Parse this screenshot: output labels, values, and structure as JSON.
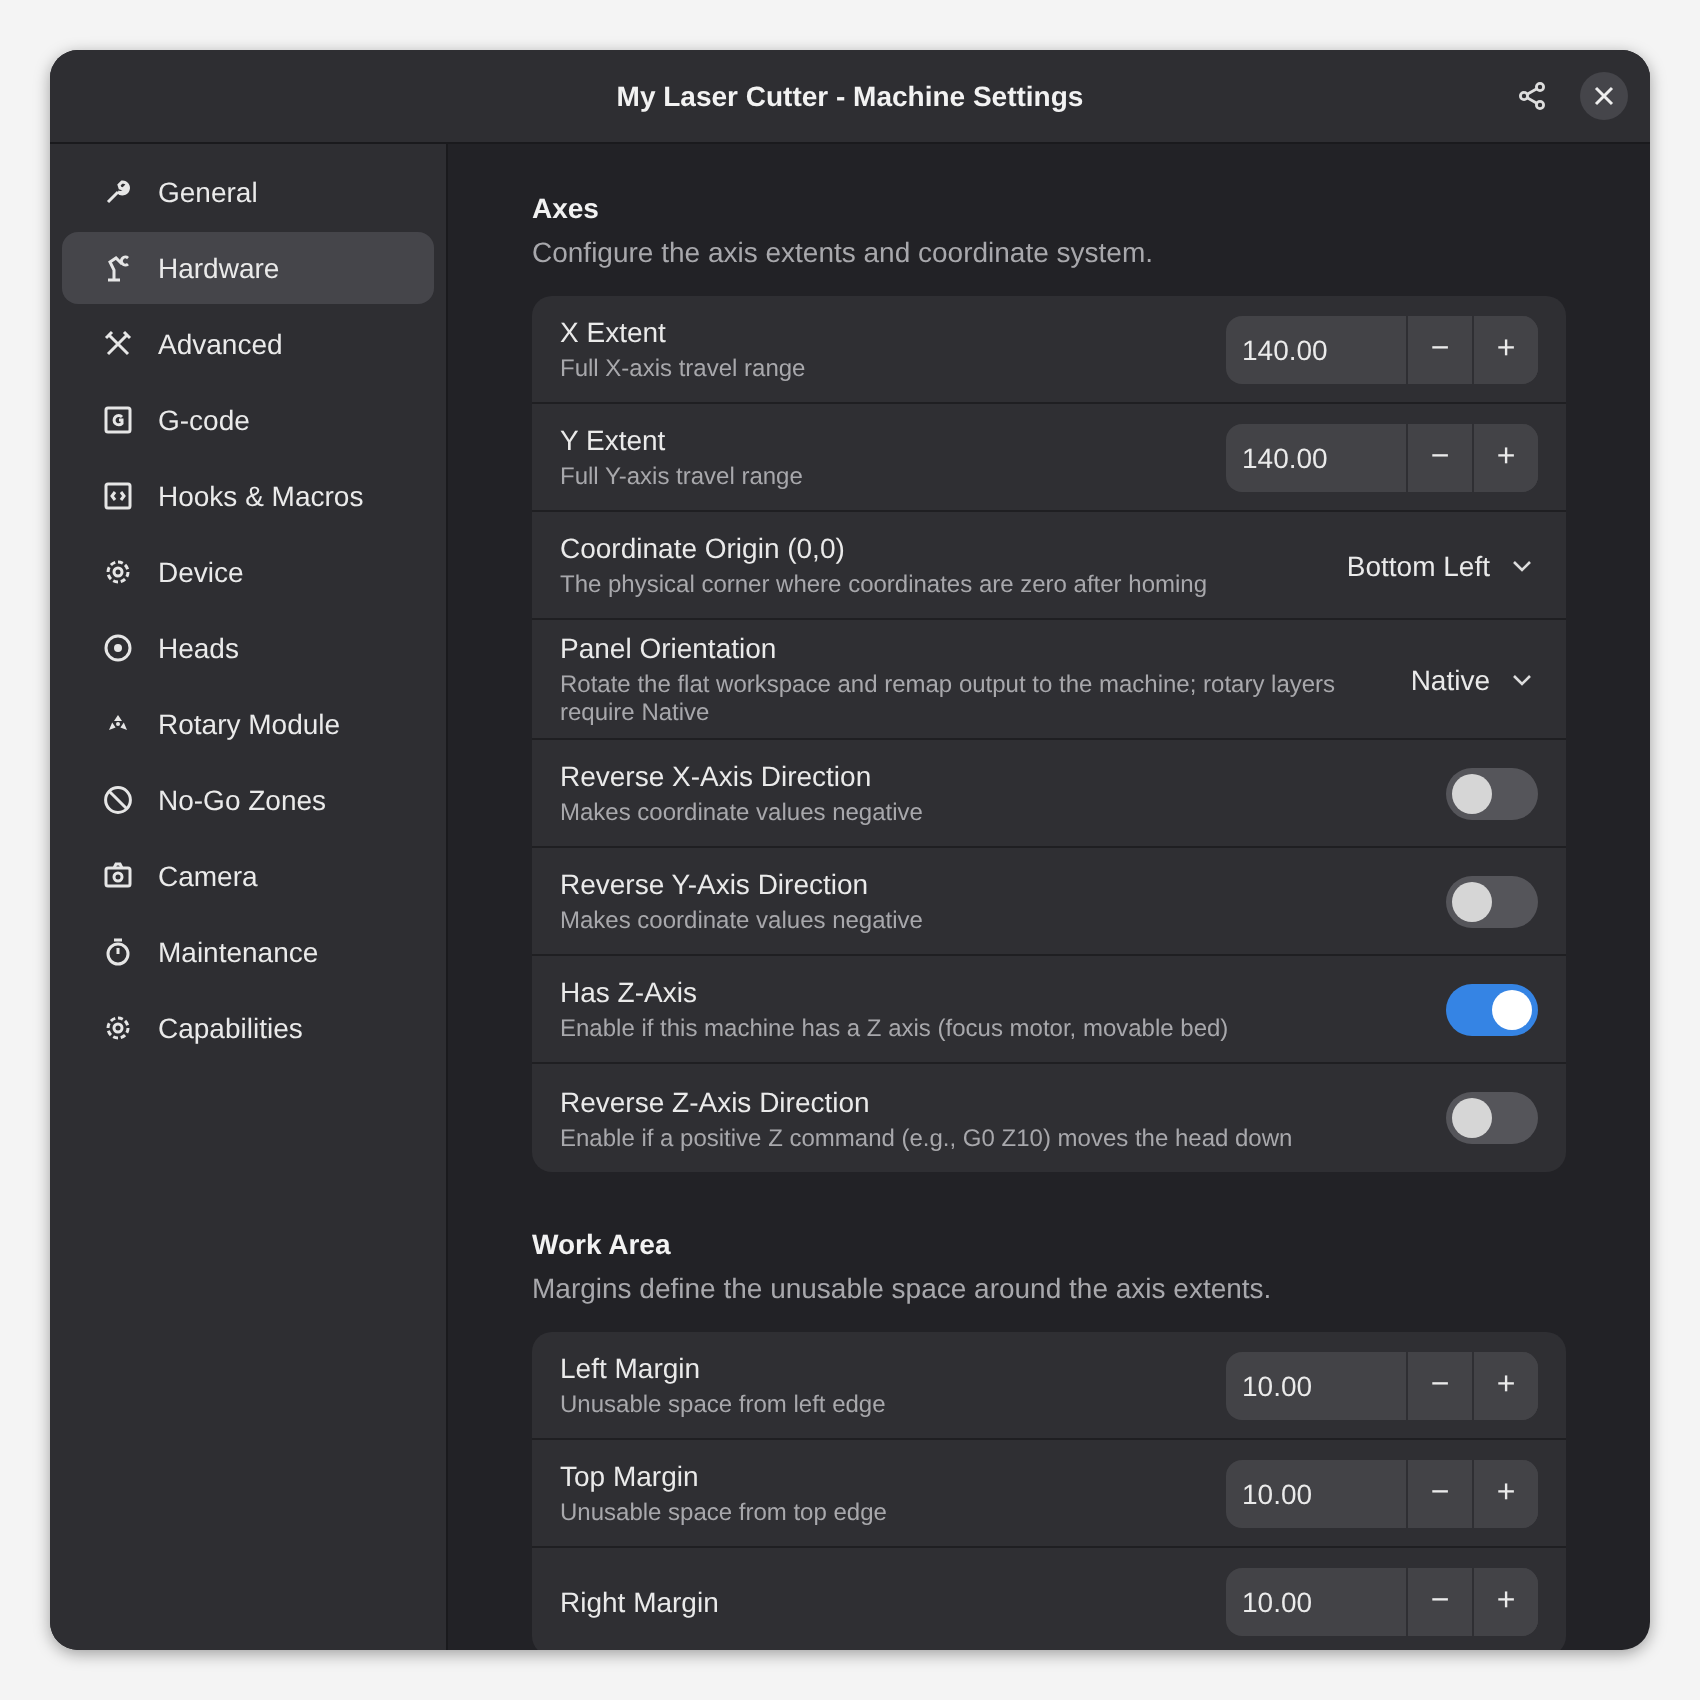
{
  "window": {
    "title": "My Laser Cutter - Machine Settings"
  },
  "sidebar": {
    "items": [
      {
        "label": "General",
        "selected": false
      },
      {
        "label": "Hardware",
        "selected": true
      },
      {
        "label": "Advanced",
        "selected": false
      },
      {
        "label": "G-code",
        "selected": false
      },
      {
        "label": "Hooks & Macros",
        "selected": false
      },
      {
        "label": "Device",
        "selected": false
      },
      {
        "label": "Heads",
        "selected": false
      },
      {
        "label": "Rotary Module",
        "selected": false
      },
      {
        "label": "No-Go Zones",
        "selected": false
      },
      {
        "label": "Camera",
        "selected": false
      },
      {
        "label": "Maintenance",
        "selected": false
      },
      {
        "label": "Capabilities",
        "selected": false
      }
    ]
  },
  "sections": [
    {
      "title": "Axes",
      "description": "Configure the axis extents and coordinate system.",
      "rows": [
        {
          "kind": "spin",
          "title": "X Extent",
          "subtitle": "Full X-axis travel range",
          "value": "140.00",
          "minus": "−",
          "plus": "+"
        },
        {
          "kind": "spin",
          "title": "Y Extent",
          "subtitle": "Full Y-axis travel range",
          "value": "140.00",
          "minus": "−",
          "plus": "+"
        },
        {
          "kind": "dropdown",
          "title": "Coordinate Origin (0,0)",
          "subtitle": "The physical corner where coordinates are zero after homing",
          "value": "Bottom Left"
        },
        {
          "kind": "dropdown",
          "title": "Panel Orientation",
          "subtitle": "Rotate the flat workspace and remap output to the machine; rotary layers require Native",
          "value": "Native"
        },
        {
          "kind": "switch",
          "title": "Reverse X-Axis Direction",
          "subtitle": "Makes coordinate values negative",
          "on": false
        },
        {
          "kind": "switch",
          "title": "Reverse Y-Axis Direction",
          "subtitle": "Makes coordinate values negative",
          "on": false
        },
        {
          "kind": "switch",
          "title": "Has Z-Axis",
          "subtitle": "Enable if this machine has a Z axis (focus motor, movable bed)",
          "on": true
        },
        {
          "kind": "switch",
          "title": "Reverse Z-Axis Direction",
          "subtitle": "Enable if a positive Z command (e.g., G0 Z10) moves the head down",
          "on": false
        }
      ]
    },
    {
      "title": "Work Area",
      "description": "Margins define the unusable space around the axis extents.",
      "rows": [
        {
          "kind": "spin",
          "title": "Left Margin",
          "subtitle": "Unusable space from left edge",
          "value": "10.00",
          "minus": "−",
          "plus": "+"
        },
        {
          "kind": "spin",
          "title": "Top Margin",
          "subtitle": "Unusable space from top edge",
          "value": "10.00",
          "minus": "−",
          "plus": "+"
        },
        {
          "kind": "spin",
          "title": "Right Margin",
          "value": "10.00",
          "minus": "−",
          "plus": "+"
        }
      ]
    }
  ]
}
